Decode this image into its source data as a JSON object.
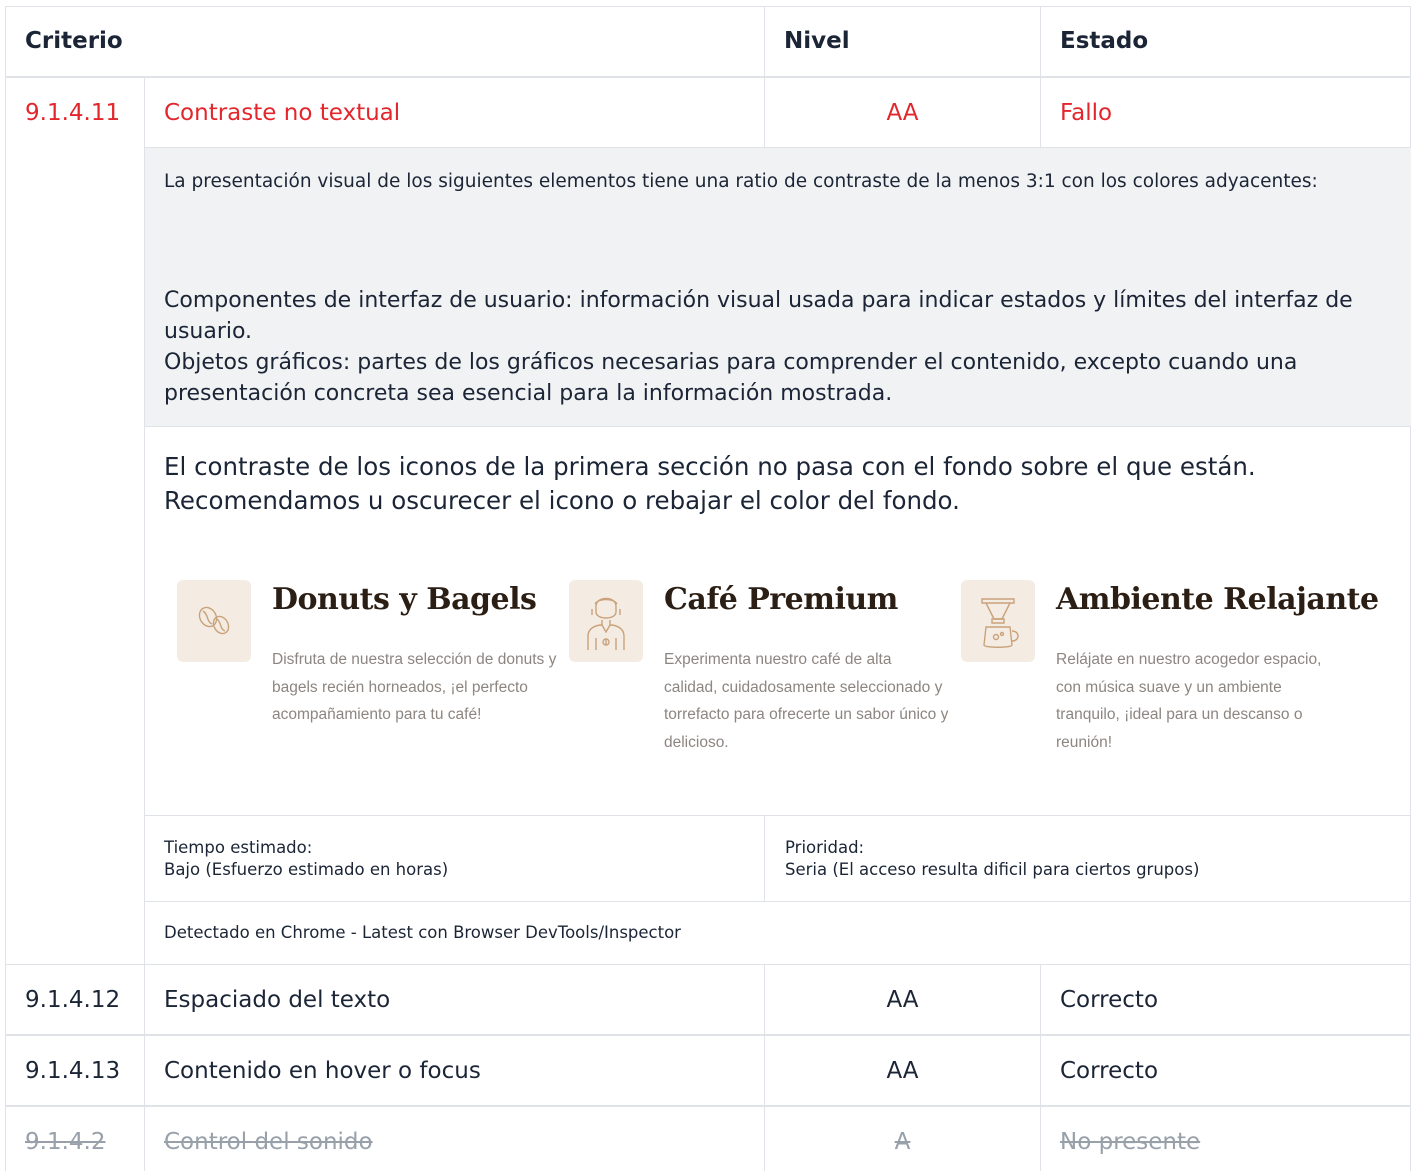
{
  "table": {
    "headers": {
      "criterio": "Criterio",
      "nivel": "Nivel",
      "estado": "Estado"
    },
    "failed_row": {
      "id": "9.1.4.11",
      "name": "Contraste no textual",
      "level": "AA",
      "status": "Fallo"
    },
    "description": {
      "intro": "La presentación visual de los siguientes elementos tiene una ratio de contraste de la menos 3:1 con los colores adyacentes:",
      "item1": "Componentes de interfaz de usuario: información visual usada para indicar estados y límites del interfaz de usuario.",
      "item2": "Objetos gráficos: partes de los gráficos necesarias para comprender el contenido, excepto cuando una presentación concreta sea esencial para la información mostrada."
    },
    "observation": "El contraste de los iconos de la primera sección no pasa con el fondo sobre el que están. Recomendamos u oscurecer el icono o rebajar el color del fondo.",
    "features": [
      {
        "icon": "coffee-beans-icon",
        "title": "Donuts y Bagels",
        "body": "Disfruta de nuestra selección de donuts y bagels recién horneados, ¡el perfecto acompañamiento para tu café!"
      },
      {
        "icon": "barista-icon",
        "title": "Café Premium",
        "body": "Experimenta nuestro café de alta calidad, cuidadosamente seleccionado y torrefacto para ofrecerte un sabor único y delicioso."
      },
      {
        "icon": "coffee-dripper-icon",
        "title": "Ambiente Relajante",
        "body": "Relájate en nuestro acogedor espacio, con música suave y un ambiente tranquilo, ¡ideal para un descanso o reunión!"
      }
    ],
    "meta": {
      "time_label": "Tiempo estimado:",
      "time_value": "Bajo (Esfuerzo estimado en horas)",
      "priority_label": "Prioridad:",
      "priority_value": "Seria (El acceso resulta dificil para ciertos grupos)",
      "detected": "Detectado en Chrome - Latest con Browser DevTools/Inspector"
    },
    "rows": [
      {
        "id": "9.1.4.12",
        "name": "Espaciado del texto",
        "level": "AA",
        "status": "Correcto"
      },
      {
        "id": "9.1.4.13",
        "name": "Contenido en hover o focus",
        "level": "AA",
        "status": "Correcto"
      },
      {
        "id": "9.1.4.2",
        "name": "Control del sonido",
        "level": "A",
        "status": "No presente"
      }
    ]
  },
  "colors": {
    "fail": "#e3262c",
    "icon": "#c9a27a",
    "icon_bg": "#f4ece3",
    "muted": "#98a0aa"
  }
}
